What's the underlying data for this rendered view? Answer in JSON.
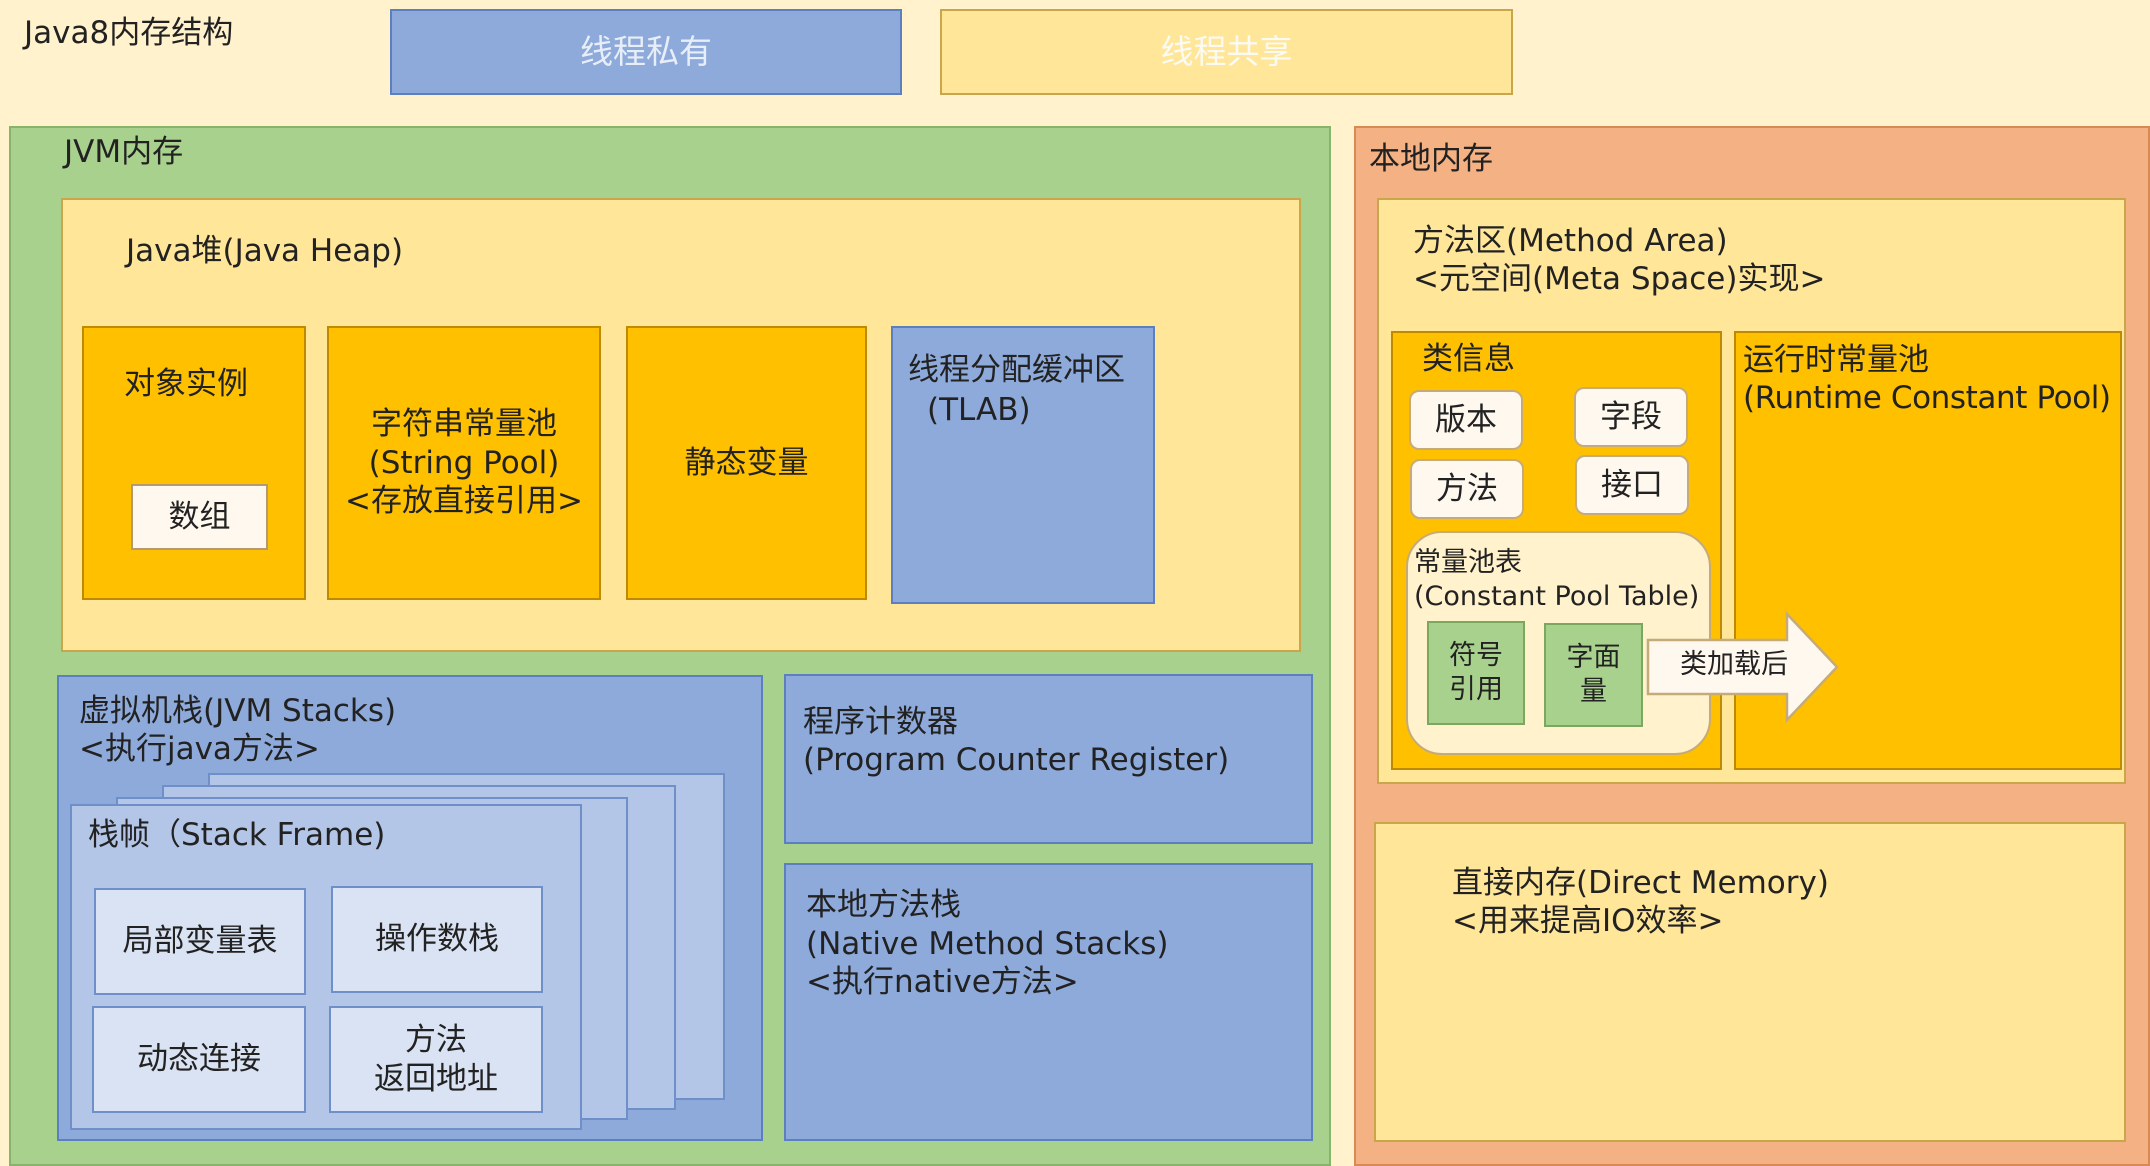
{
  "title": "Java8内存结构",
  "legend": {
    "private": "线程私有",
    "shared": "线程共享"
  },
  "jvm": {
    "label": "JVM内存",
    "heap": {
      "label": "Java堆(Java Heap)",
      "objects": {
        "label": "对象实例",
        "array": "数组"
      },
      "string_pool": {
        "line1": "字符串常量池",
        "line2": "(String Pool)",
        "line3": "<存放直接引用>"
      },
      "static_vars": "静态变量",
      "tlab": {
        "line1": "线程分配缓冲区",
        "line2": "(TLAB)"
      }
    },
    "stacks": {
      "line1": "虚拟机栈(JVM Stacks)",
      "line2": "<执行java方法>",
      "frame": {
        "label": "栈帧（Stack Frame)",
        "local_vars": "局部变量表",
        "operand_stack": "操作数栈",
        "dynamic_link": "动态连接",
        "return_line1": "方法",
        "return_line2": "返回地址"
      }
    },
    "pc": {
      "line1": "程序计数器",
      "line2": "(Program Counter Register)"
    },
    "native": {
      "line1": "本地方法栈",
      "line2": "(Native Method Stacks)",
      "line3": "<执行native方法>"
    }
  },
  "native_memory": {
    "label": "本地内存",
    "method_area": {
      "line1": "方法区(Method Area)",
      "line2": "<元空间(Meta Space)实现>",
      "class_info": {
        "label": "类信息",
        "version": "版本",
        "field": "字段",
        "method": "方法",
        "interface": "接口",
        "cp_table": {
          "line1": "常量池表",
          "line2": "(Constant Pool Table)",
          "symbol_ref_1": "符号",
          "symbol_ref_2": "引用",
          "literal_1": "字面",
          "literal_2": "量"
        }
      },
      "arrow_label": "类加载后",
      "runtime_cp": {
        "line1": "运行时常量池",
        "line2": "(Runtime Constant Pool)"
      }
    },
    "direct": {
      "line1": "直接内存(Direct Memory)",
      "line2": "<用来提高IO效率>"
    }
  },
  "colors": {
    "background": "#fff2cc",
    "thread_private": "#8eaadb",
    "thread_shared": "#ffe699",
    "jvm_memory": "#a9d18e",
    "native_memory": "#f4b183",
    "heap_items": "#ffc000"
  }
}
